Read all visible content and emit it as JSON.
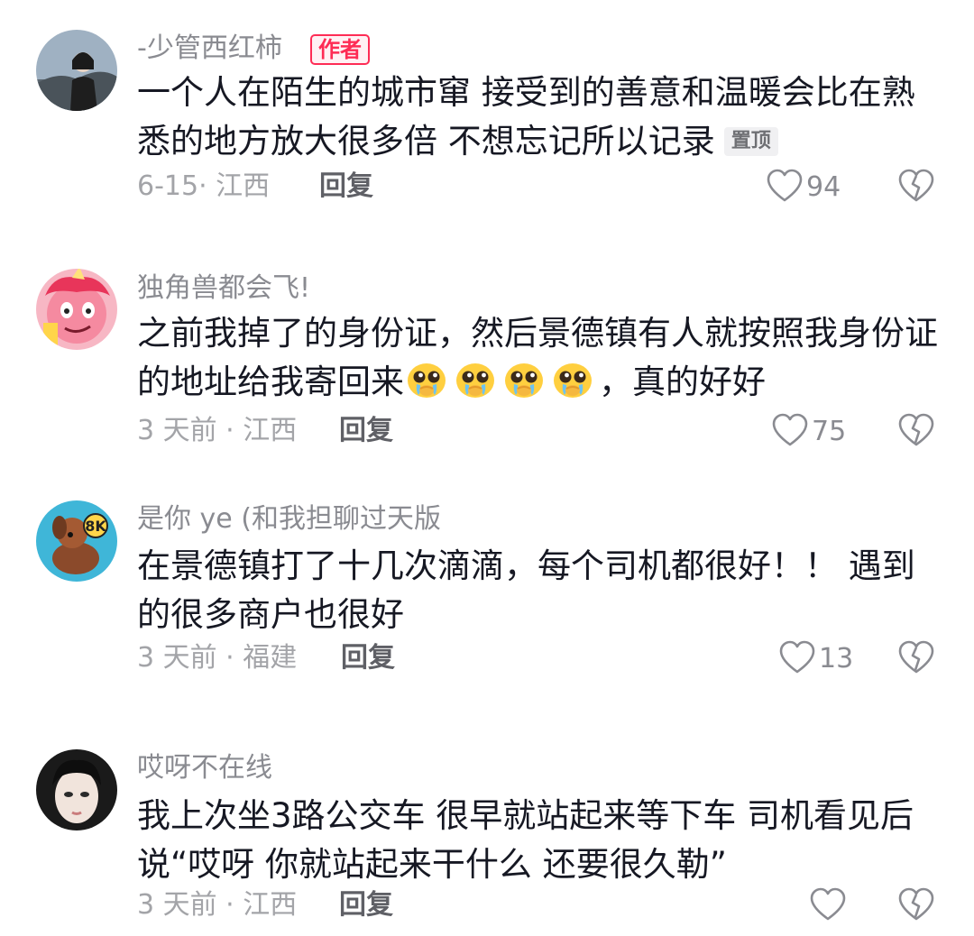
{
  "comments": [
    {
      "username": "-少管西红柿",
      "author_badge": "作者",
      "text": "一个人在陌生的城市窜 接受到的善意和温暖会比在熟悉的地方放大很多倍 不想忘记所以记录",
      "pinned_label": "置顶",
      "date_location": "6-15· 江西",
      "reply_label": "回复",
      "likes": "94",
      "avatar": "photo-avatar-icon"
    },
    {
      "username": "独角兽都会飞!",
      "text_before": "之前我掉了的身份证，然后景德镇有人就按照我身份证的地址给我寄回来",
      "text_after": "，真的好好",
      "emoji": "pleading-face-icon",
      "emoji_count": 4,
      "date_location": "3 天前 · 江西",
      "reply_label": "回复",
      "likes": "75",
      "avatar": "pink-cartoon-avatar-icon"
    },
    {
      "username": "是你 ye (和我担聊过天版",
      "text": "在景德镇打了十几次滴滴，每个司机都很好！！ 遇到的很多商户也很好",
      "date_location": "3 天前 · 福建",
      "reply_label": "回复",
      "likes": "13",
      "avatar": "dog-cartoon-avatar-icon"
    },
    {
      "username": "哎呀不在线",
      "text": "我上次坐3路公交车 很早就站起来等下车 司机看见后说“哎呀 你就站起来干什么 还要很久勒”",
      "date_location": "3 天前 · 江西",
      "reply_label": "回复",
      "likes": "",
      "avatar": "face-photo-avatar-icon"
    }
  ],
  "colors": {
    "accent": "#fe2c55",
    "text": "#161823",
    "muted": "#a3a4a8"
  }
}
